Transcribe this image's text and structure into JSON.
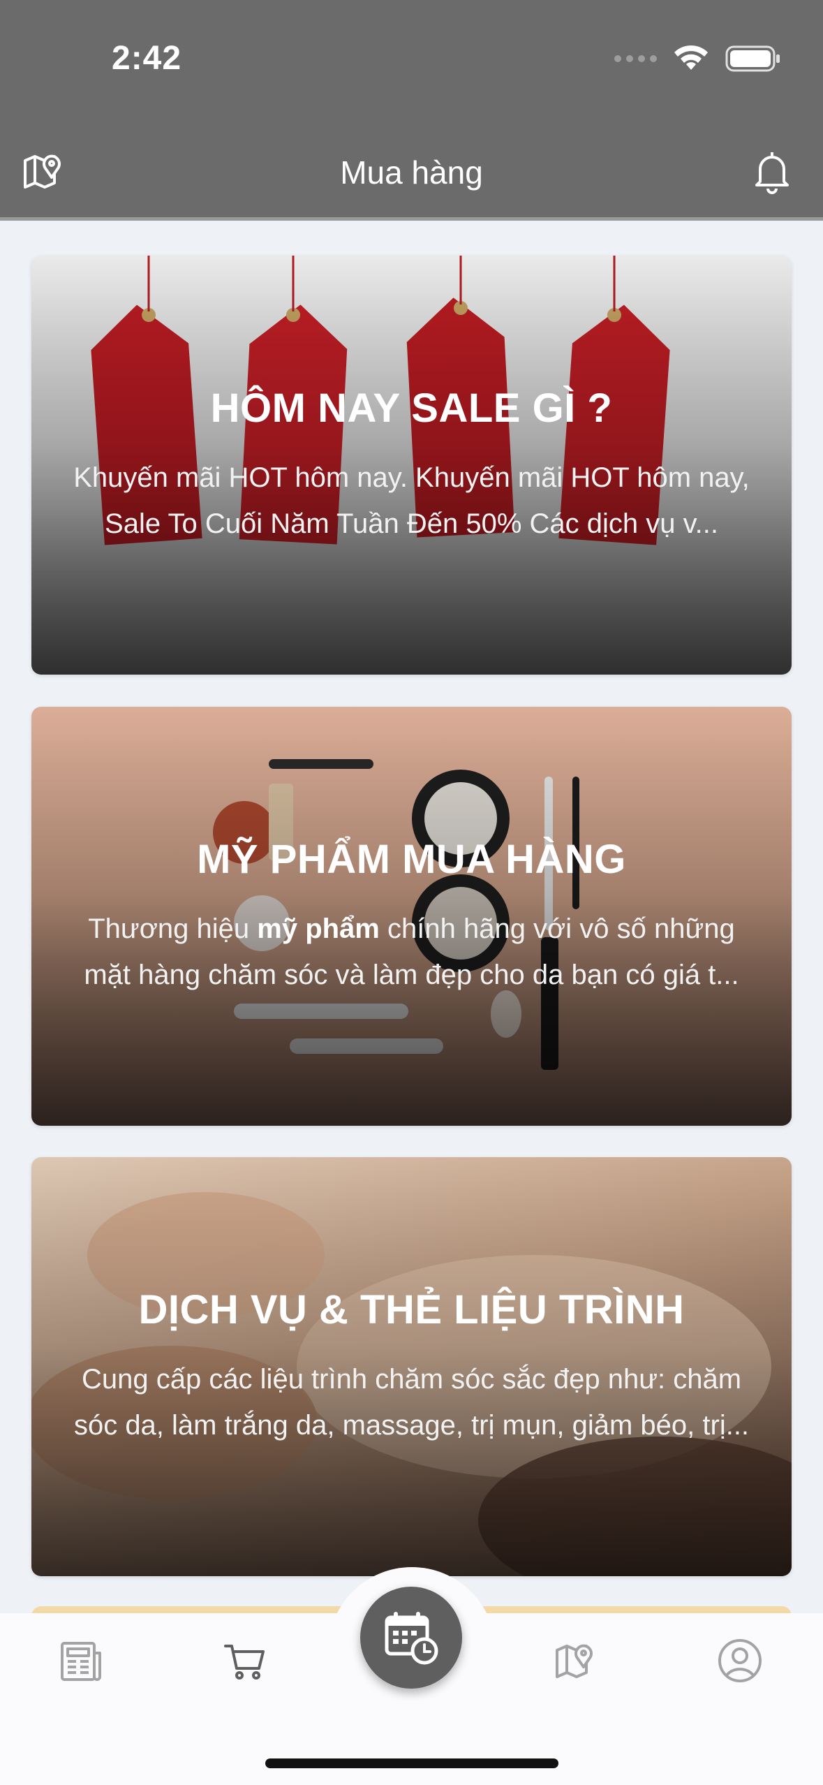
{
  "status_bar": {
    "time": "2:42"
  },
  "header": {
    "title": "Mua hàng",
    "left_icon": "map-pin-icon",
    "right_icon": "bell-icon"
  },
  "cards": [
    {
      "title": "HÔM NAY SALE GÌ ?",
      "description": "Khuyến mãi HOT hôm nay. Khuyến mãi HOT hôm nay, Sale To Cuối Năm Tuần Đến 50% Các dịch vụ v..."
    },
    {
      "title": "MỸ PHẨM MUA HÀNG",
      "description_pre": "Thương hiệu ",
      "description_bold": "mỹ phẩm",
      "description_post": " chính hãng với vô số những mặt hàng chăm sóc và làm đẹp cho da bạn có giá t..."
    },
    {
      "title": "DỊCH VỤ & THẺ LIỆU TRÌNH",
      "description": "Cung cấp các liệu trình chăm sóc sắc đẹp như: chăm sóc da, làm trắng da, massage, trị mụn, giảm béo, trị..."
    }
  ],
  "tabbar": {
    "tabs": [
      "news-icon",
      "cart-icon",
      "calendar-clock-icon",
      "map-pin-icon",
      "user-icon"
    ],
    "active_color": "#5f5f5f",
    "inactive_color": "#9e9e9e"
  }
}
